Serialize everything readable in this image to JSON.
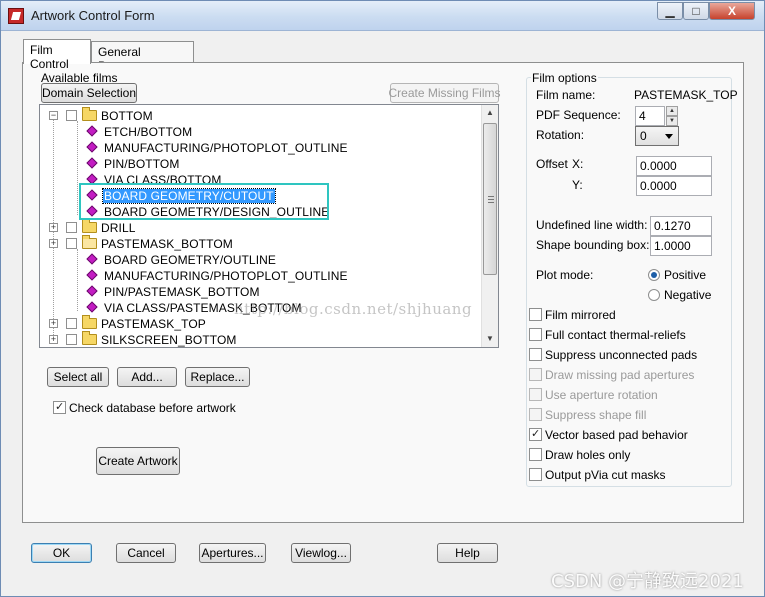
{
  "window": {
    "title": "Artwork Control Form",
    "min_label": "▁",
    "max_label": "□",
    "close_label": "X"
  },
  "tabs": [
    {
      "label": "Film Control",
      "active": true
    },
    {
      "label": "General Parameters",
      "active": false
    }
  ],
  "film_control": {
    "available_films_label": "Available films",
    "domain_selection_label": "Domain Selection",
    "create_missing_label": "Create Missing Films",
    "tree": [
      {
        "label": "BOTTOM",
        "type": "folder",
        "level": 0,
        "expander": "−"
      },
      {
        "label": "ETCH/BOTTOM",
        "type": "item",
        "level": 1
      },
      {
        "label": "MANUFACTURING/PHOTOPLOT_OUTLINE",
        "type": "item",
        "level": 1
      },
      {
        "label": "PIN/BOTTOM",
        "type": "item",
        "level": 1
      },
      {
        "label": "VIA CLASS/BOTTOM",
        "type": "item",
        "level": 1
      },
      {
        "label": "BOARD GEOMETRY/CUTOUT",
        "type": "item",
        "level": 1,
        "selected": true
      },
      {
        "label": "BOARD GEOMETRY/DESIGN_OUTLINE",
        "type": "item",
        "level": 1
      },
      {
        "label": "DRILL",
        "type": "folder",
        "level": 0,
        "expander": "+"
      },
      {
        "label": "PASTEMASK_BOTTOM",
        "type": "folder-open",
        "level": 0,
        "expander": "+"
      },
      {
        "label": "BOARD GEOMETRY/OUTLINE",
        "type": "item",
        "level": 1
      },
      {
        "label": "MANUFACTURING/PHOTOPLOT_OUTLINE",
        "type": "item",
        "level": 1
      },
      {
        "label": "PIN/PASTEMASK_BOTTOM",
        "type": "item",
        "level": 1
      },
      {
        "label": "VIA CLASS/PASTEMASK_BOTTOM",
        "type": "item",
        "level": 1
      },
      {
        "label": "PASTEMASK_TOP",
        "type": "folder",
        "level": 0,
        "expander": "+"
      },
      {
        "label": "SILKSCREEN_BOTTOM",
        "type": "folder",
        "level": 0,
        "expander": "+"
      }
    ],
    "select_all_label": "Select all",
    "add_label": "Add...",
    "replace_label": "Replace...",
    "check_database_label": "Check database before artwork",
    "create_artwork_label": "Create Artwork"
  },
  "film_options": {
    "group_label": "Film options",
    "film_name_label": "Film name:",
    "film_name_value": "PASTEMASK_TOP",
    "pdf_sequence_label": "PDF Sequence:",
    "pdf_sequence_value": "4",
    "rotation_label": "Rotation:",
    "rotation_value": "0",
    "offset_label": "Offset",
    "x_label": "X:",
    "x_value": "0.0000",
    "y_label": "Y:",
    "y_value": "0.0000",
    "undefined_line_width_label": "Undefined line width:",
    "undefined_line_width_value": "0.1270",
    "shape_bounding_box_label": "Shape bounding box:",
    "shape_bounding_box_value": "1.0000",
    "plot_mode_label": "Plot mode:",
    "positive_label": "Positive",
    "negative_label": "Negative",
    "options": [
      {
        "label": "Film mirrored",
        "checked": false,
        "enabled": true
      },
      {
        "label": "Full contact thermal-reliefs",
        "checked": false,
        "enabled": true
      },
      {
        "label": "Suppress unconnected pads",
        "checked": false,
        "enabled": true
      },
      {
        "label": "Draw missing pad apertures",
        "checked": false,
        "enabled": false
      },
      {
        "label": "Use aperture rotation",
        "checked": false,
        "enabled": false
      },
      {
        "label": "Suppress shape fill",
        "checked": false,
        "enabled": false
      },
      {
        "label": "Vector based pad behavior",
        "checked": true,
        "enabled": true
      },
      {
        "label": "Draw holes only",
        "checked": false,
        "enabled": true
      },
      {
        "label": "Output pVia cut masks",
        "checked": false,
        "enabled": true
      }
    ]
  },
  "footer": {
    "ok_label": "OK",
    "cancel_label": "Cancel",
    "apertures_label": "Apertures...",
    "viewlog_label": "Viewlog...",
    "help_label": "Help"
  },
  "watermarks": {
    "middle": "http://blog.csdn.net/shjhuang",
    "corner": "CSDN @宁静致远2021"
  }
}
